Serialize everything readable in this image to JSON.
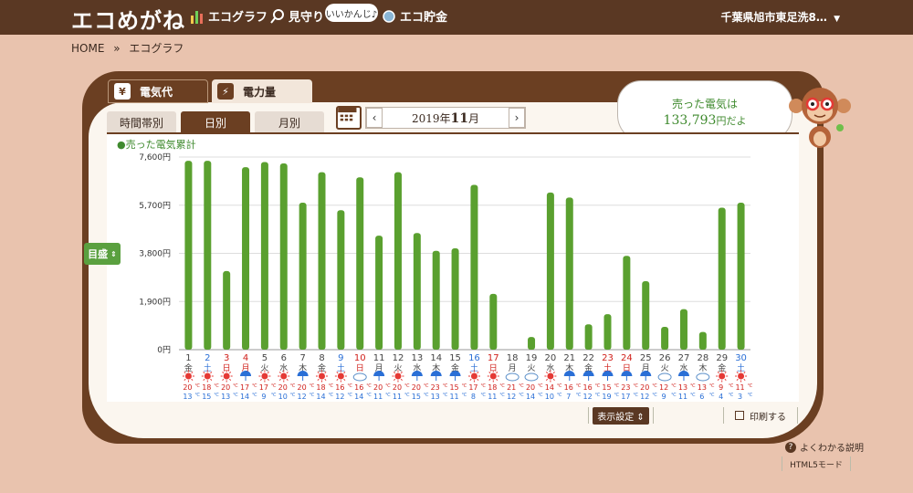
{
  "header": {
    "logo": "エコめがね",
    "nav": [
      {
        "label": "エコグラフ",
        "icon": "bar-chart-icon"
      },
      {
        "label": "見守り",
        "icon": "magnifier-icon"
      },
      {
        "label": "エコ貯金",
        "icon": "coin-icon"
      }
    ],
    "badge": "いいかんじ♪",
    "location": "千葉県旭市東足洗8…"
  },
  "breadcrumb": {
    "home": "HOME",
    "sep": "»",
    "current": "エコグラフ"
  },
  "tabs": {
    "main": [
      "電気代",
      "電力量"
    ],
    "main_icons": [
      "yen-icon",
      "lightning-icon"
    ]
  },
  "subtabs": [
    "時間帯別",
    "日別",
    "月別"
  ],
  "date": {
    "year_label": "2019年",
    "month": "11",
    "month_suffix": "月",
    "prev": "‹",
    "next": "›"
  },
  "bubble": {
    "line1": "売った電気は",
    "amount": "133,793",
    "suffix": "円だよ"
  },
  "legend": "●売った電気累計",
  "side_button": "目盛",
  "controls": {
    "display_settings": "表示設定",
    "print": "印刷する",
    "help": "よくわかる説明",
    "html5": "HTML5モード"
  },
  "colors": {
    "bar": "#5aa02f",
    "header": "#5a3823",
    "accent_green": "#3f8a2e",
    "sunday": "#d0201b",
    "saturday": "#2a6fd6"
  },
  "chart_data": {
    "type": "bar",
    "title": "",
    "series_label": "売った電気累計",
    "ylim": [
      0,
      7600
    ],
    "yticks": [
      {
        "v": 0,
        "label": "0円"
      },
      {
        "v": 1900,
        "label": "1,900円"
      },
      {
        "v": 3800,
        "label": "3,800円"
      },
      {
        "v": 5700,
        "label": "5,700円"
      },
      {
        "v": 7600,
        "label": "7,600円"
      }
    ],
    "days": [
      "1",
      "2",
      "3",
      "4",
      "5",
      "6",
      "7",
      "8",
      "9",
      "10",
      "11",
      "12",
      "13",
      "14",
      "15",
      "16",
      "17",
      "18",
      "19",
      "20",
      "21",
      "22",
      "23",
      "24",
      "25",
      "26",
      "27",
      "28",
      "29",
      "30"
    ],
    "weekdays": [
      "金",
      "土",
      "日",
      "月",
      "火",
      "水",
      "木",
      "金",
      "土",
      "日",
      "月",
      "火",
      "水",
      "木",
      "金",
      "土",
      "日",
      "月",
      "火",
      "水",
      "木",
      "金",
      "土",
      "日",
      "月",
      "火",
      "水",
      "木",
      "金",
      "土"
    ],
    "day_colors": [
      "normal",
      "sat",
      "sun",
      "sun",
      "normal",
      "normal",
      "normal",
      "normal",
      "sat",
      "sun",
      "normal",
      "normal",
      "normal",
      "normal",
      "normal",
      "sat",
      "sun",
      "normal",
      "normal",
      "normal",
      "normal",
      "normal",
      "sun",
      "sun",
      "normal",
      "normal",
      "normal",
      "normal",
      "normal",
      "sat"
    ],
    "values": [
      7450,
      7450,
      3100,
      7200,
      7400,
      7350,
      5800,
      7000,
      5500,
      6800,
      4500,
      7000,
      4600,
      3900,
      4000,
      6500,
      2200,
      0,
      500,
      6200,
      6000,
      1000,
      1400,
      3700,
      2700,
      900,
      1600,
      700,
      5600,
      5800
    ],
    "weather": [
      "sun",
      "sun",
      "sun",
      "umbrella",
      "sun",
      "sun",
      "umbrella",
      "sun",
      "sun",
      "cloud",
      "umbrella",
      "sun",
      "umbrella",
      "umbrella",
      "umbrella",
      "sun",
      "sun",
      "cloud",
      "cloud",
      "sun",
      "umbrella",
      "umbrella",
      "umbrella",
      "umbrella",
      "umbrella",
      "cloud",
      "umbrella",
      "cloud",
      "sun",
      "sun"
    ],
    "high_temps": [
      "20",
      "18",
      "20",
      "17",
      "17",
      "20",
      "20",
      "18",
      "16",
      "16",
      "20",
      "20",
      "20",
      "23",
      "15",
      "17",
      "18",
      "21",
      "20",
      "14",
      "16",
      "16",
      "15",
      "23",
      "20",
      "12",
      "13",
      "13",
      "9",
      "11"
    ],
    "low_temps": [
      "13",
      "15",
      "13",
      "14",
      "9",
      "10",
      "12",
      "14",
      "12",
      "14",
      "11",
      "11",
      "15",
      "13",
      "11",
      "8",
      "11",
      "12",
      "14",
      "10",
      "7",
      "12",
      "19",
      "17",
      "12",
      "9",
      "11",
      "6",
      "4",
      "3"
    ],
    "temp_unit": "℃"
  }
}
